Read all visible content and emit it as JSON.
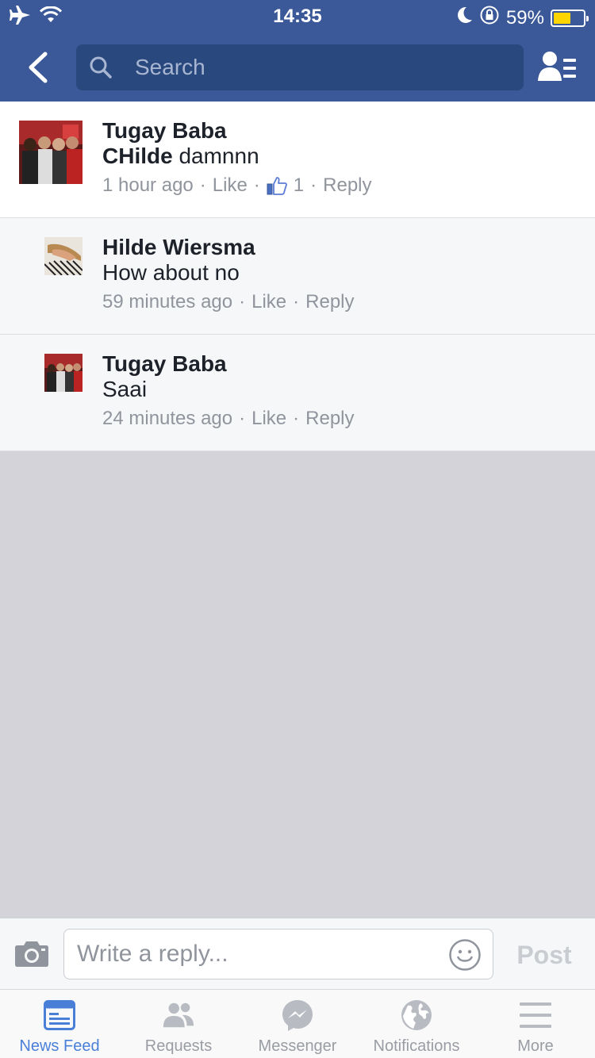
{
  "status_bar": {
    "time": "14:35",
    "battery_percent": "59%",
    "battery_level": 0.59,
    "icons": [
      "airplane-icon",
      "wifi-icon",
      "moon-icon",
      "rotation-lock-icon",
      "battery-icon"
    ]
  },
  "header": {
    "search_placeholder": "Search",
    "back_icon": "chevron-left-icon",
    "friends_icon": "friends-list-icon"
  },
  "comments": [
    {
      "author": "Tugay Baba",
      "mention": "CHilde",
      "text": " damnnn",
      "time": "1 hour ago",
      "like_label": "Like",
      "like_count": "1",
      "reply_label": "Reply"
    },
    {
      "author": "Hilde Wiersma",
      "text": "How about no",
      "time": "59 minutes ago",
      "like_label": "Like",
      "reply_label": "Reply"
    },
    {
      "author": "Tugay Baba",
      "text": "Saai",
      "time": "24 minutes ago",
      "like_label": "Like",
      "reply_label": "Reply"
    }
  ],
  "reply_bar": {
    "placeholder": "Write a reply...",
    "post_label": "Post"
  },
  "tabs": [
    {
      "label": "News Feed",
      "icon": "news-feed-icon",
      "active": true
    },
    {
      "label": "Requests",
      "icon": "requests-icon",
      "active": false
    },
    {
      "label": "Messenger",
      "icon": "messenger-icon",
      "active": false
    },
    {
      "label": "Notifications",
      "icon": "globe-icon",
      "active": false
    },
    {
      "label": "More",
      "icon": "menu-icon",
      "active": false
    }
  ],
  "colors": {
    "brand": "#3b5998",
    "search_bg": "#29487d",
    "active_tab": "#4a7fd8",
    "muted_text": "#90949c"
  }
}
